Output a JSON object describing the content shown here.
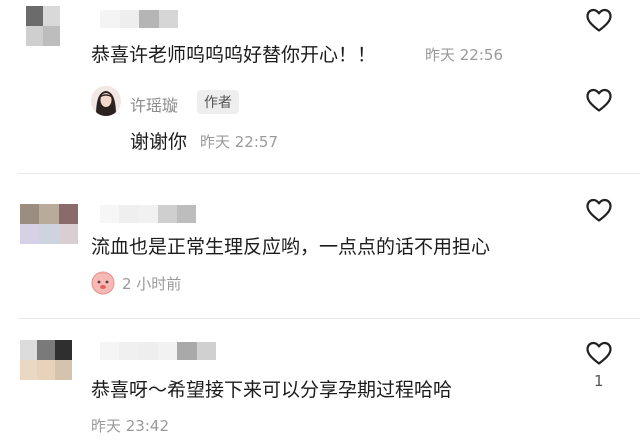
{
  "comments": [
    {
      "text": "恭喜许老师呜呜呜好替你开心！！",
      "time": "昨天 22:56",
      "reply": {
        "name": "许瑶璇",
        "tag": "作者",
        "text": "谢谢你",
        "time": "昨天 22:57"
      }
    },
    {
      "text": "流血也是正常生理反应哟，一点点的话不用担心",
      "time": "2 小时前"
    },
    {
      "text": "恭喜呀～希望接下来可以分享孕期过程哈哈",
      "time": "昨天 23:42",
      "likes": "1"
    }
  ],
  "icons": {
    "like": "heart-outline-icon",
    "sticker": "pink-sticker-icon"
  }
}
